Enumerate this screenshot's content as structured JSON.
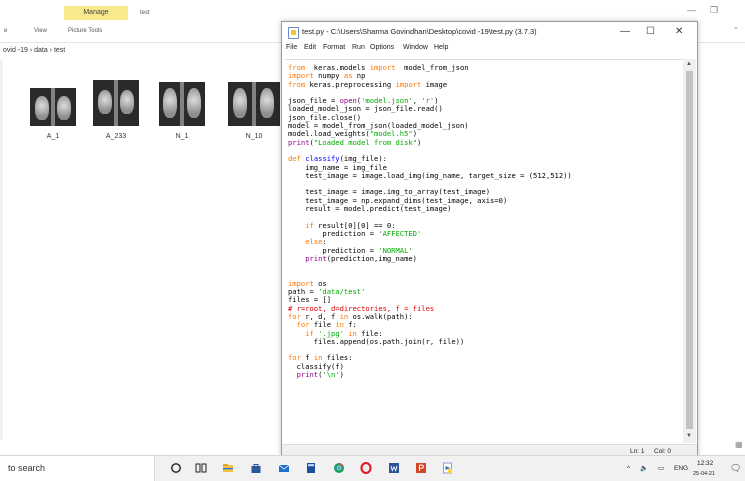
{
  "explorer": {
    "ribbon": {
      "manage_tab": "Manage",
      "title_suffix": "test",
      "view_tab": "View",
      "picture_tools_tab": "Picture Tools",
      "file_tab": "e"
    },
    "breadcrumb": "ovid -19  ›  data  ›  test",
    "thumbnails": [
      {
        "label": "A_1"
      },
      {
        "label": "A_233"
      },
      {
        "label": "N_1"
      },
      {
        "label": "N_10"
      }
    ]
  },
  "idle_window": {
    "title": "test.py - C:\\Users\\Sharma Govindhan\\Desktop\\covid -19\\test.py (3.7.3)",
    "controls": {
      "minimize": "—",
      "maximize": "☐",
      "close": "✕"
    },
    "menus": [
      "File",
      "Edit",
      "Format",
      "Run",
      "Options",
      "Window",
      "Help"
    ],
    "code_lines": [
      [
        [
          "kw",
          "from"
        ],
        [
          "",
          "  keras.models "
        ],
        [
          "kw",
          "import"
        ],
        [
          "",
          "  model_from_json"
        ]
      ],
      [
        [
          "kw",
          "import"
        ],
        [
          "",
          " numpy "
        ],
        [
          "kw",
          "as"
        ],
        [
          "",
          " np"
        ]
      ],
      [
        [
          "kw",
          "from"
        ],
        [
          "",
          " keras.preprocessing "
        ],
        [
          "kw",
          "import"
        ],
        [
          "",
          " image"
        ]
      ],
      [],
      [
        [
          "",
          "json_file = "
        ],
        [
          "bi",
          "open"
        ],
        [
          "",
          "("
        ],
        [
          "st",
          "'model.json'"
        ],
        [
          "",
          ", "
        ],
        [
          "st",
          "'r'"
        ],
        [
          "",
          ")"
        ]
      ],
      [
        [
          "",
          "loaded_model_json = json_file.read()"
        ]
      ],
      [
        [
          "",
          "json_file.close()"
        ]
      ],
      [
        [
          "",
          "model = model_from_json(loaded_model_json)"
        ]
      ],
      [
        [
          "",
          "model.load_weights("
        ],
        [
          "st",
          "\"model.h5\""
        ],
        [
          "",
          ")"
        ]
      ],
      [
        [
          "bi",
          "print"
        ],
        [
          "",
          "("
        ],
        [
          "st",
          "\"Loaded model from disk\""
        ],
        [
          "",
          ")"
        ]
      ],
      [],
      [
        [
          "kw",
          "def"
        ],
        [
          "",
          " "
        ],
        [
          "fn",
          "classify"
        ],
        [
          "",
          "(img_file):"
        ]
      ],
      [
        [
          "",
          "    img_name = img_file"
        ]
      ],
      [
        [
          "",
          "    test_image = image.load_img(img_name, target_size = (512,512))"
        ]
      ],
      [],
      [
        [
          "",
          "    test_image = image.img_to_array(test_image)"
        ]
      ],
      [
        [
          "",
          "    test_image = np.expand_dims(test_image, axis=0)"
        ]
      ],
      [
        [
          "",
          "    result = model.predict(test_image)"
        ]
      ],
      [],
      [
        [
          "",
          "    "
        ],
        [
          "kw",
          "if"
        ],
        [
          "",
          " result[0][0] == 0:"
        ]
      ],
      [
        [
          "",
          "        prediction = "
        ],
        [
          "st",
          "'AFFECTED'"
        ]
      ],
      [
        [
          "",
          "    "
        ],
        [
          "kw",
          "else"
        ],
        [
          "",
          ":"
        ]
      ],
      [
        [
          "",
          "        prediction = "
        ],
        [
          "st",
          "'NORMAL'"
        ]
      ],
      [
        [
          "",
          "    "
        ],
        [
          "bi",
          "print"
        ],
        [
          "",
          "(prediction,img_name)"
        ]
      ],
      [],
      [],
      [
        [
          "kw",
          "import"
        ],
        [
          "",
          " os"
        ]
      ],
      [
        [
          "",
          "path = "
        ],
        [
          "st",
          "'data/test'"
        ]
      ],
      [
        [
          "",
          "files = []"
        ]
      ],
      [
        [
          "cm",
          "# r=root, d=directories, f = files"
        ]
      ],
      [
        [
          "kw",
          "for"
        ],
        [
          "",
          " r, d, f "
        ],
        [
          "kw",
          "in"
        ],
        [
          "",
          " os.walk(path):"
        ]
      ],
      [
        [
          "",
          "  "
        ],
        [
          "kw",
          "for"
        ],
        [
          "",
          " file "
        ],
        [
          "kw",
          "in"
        ],
        [
          "",
          " f:"
        ]
      ],
      [
        [
          "",
          "    "
        ],
        [
          "kw",
          "if"
        ],
        [
          "",
          " "
        ],
        [
          "st",
          "'.jpg'"
        ],
        [
          "",
          " "
        ],
        [
          "kw",
          "in"
        ],
        [
          "",
          " file:"
        ]
      ],
      [
        [
          "",
          "      files.append(os.path.join(r, file))"
        ]
      ],
      [],
      [
        [
          "kw",
          "for"
        ],
        [
          "",
          " f "
        ],
        [
          "kw",
          "in"
        ],
        [
          "",
          " files:"
        ]
      ],
      [
        [
          "",
          "  classify(f)"
        ]
      ],
      [
        [
          "",
          "  "
        ],
        [
          "bi",
          "print"
        ],
        [
          "",
          "("
        ],
        [
          "st",
          "'\\n'"
        ],
        [
          "",
          ")"
        ]
      ]
    ],
    "status": {
      "line": "Ln: 1",
      "col": "Col: 0"
    }
  },
  "taskbar": {
    "search_text": "to search",
    "tray": {
      "lang": "ENG",
      "time": "12:32",
      "date": "25-04-21"
    }
  },
  "colors": {
    "keyword": "#ff7700",
    "string": "#00aa00",
    "builtin": "#900090",
    "comment": "#dd0000",
    "defname": "#0000ff"
  }
}
